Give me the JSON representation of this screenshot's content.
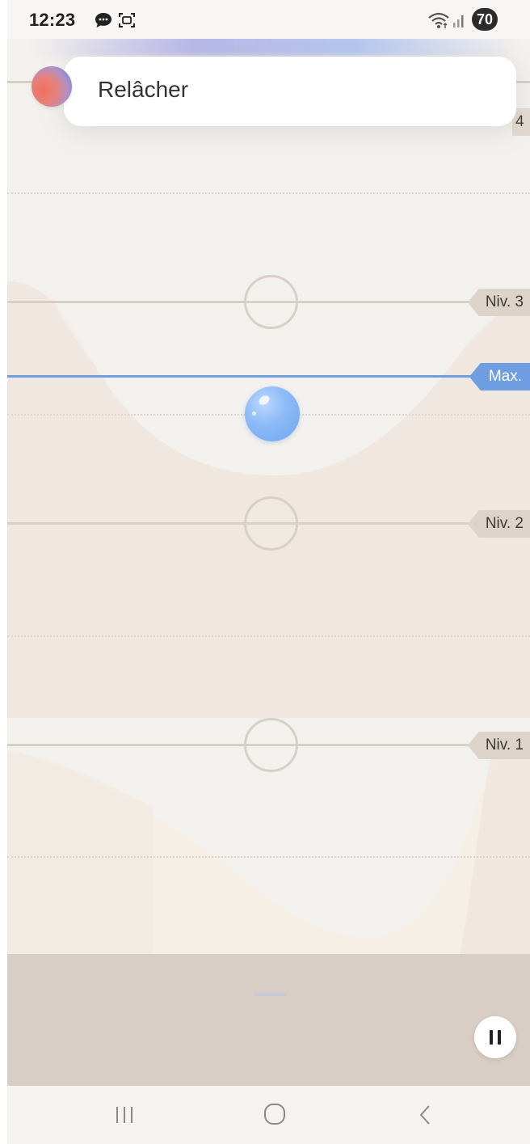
{
  "status_bar": {
    "time": "12:23",
    "battery": "70",
    "icons": [
      "chat-icon",
      "screenshot-icon",
      "wifi-icon",
      "signal-icon"
    ]
  },
  "notification": {
    "text": "Relâcher",
    "icon": "app-orb"
  },
  "levels": {
    "top_partial": "4",
    "level3": "Niv. 3",
    "max": "Max.",
    "level2": "Niv. 2",
    "level1": "Niv. 1"
  },
  "colors": {
    "accent_blue": "#6e9de2",
    "tag_beige": "#ddd3c9",
    "panel_beige": "#d8cec5"
  },
  "bottom_panel": {
    "pause_icon": "pause-icon"
  },
  "nav_bar": {
    "icons": [
      "recents-icon",
      "home-icon",
      "back-icon"
    ]
  }
}
